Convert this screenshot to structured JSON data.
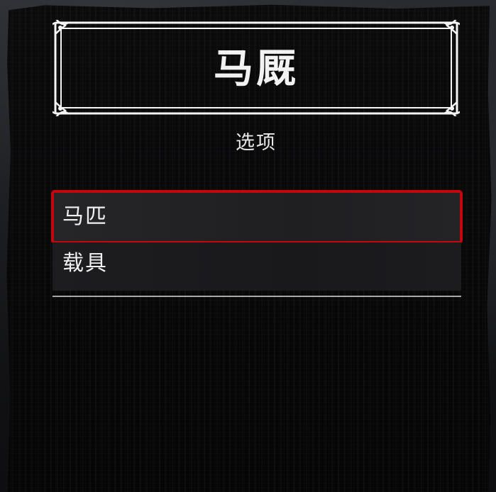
{
  "header": {
    "title": "马厩",
    "subtitle": "选项"
  },
  "menu": {
    "items": [
      {
        "label": "马匹",
        "selected": true
      },
      {
        "label": "载具",
        "selected": false
      }
    ]
  },
  "colors": {
    "selection_outline": "#c4060d",
    "text": "#f0f0f0",
    "background": "#0a0a0b",
    "divider": "#a9a9ad"
  }
}
